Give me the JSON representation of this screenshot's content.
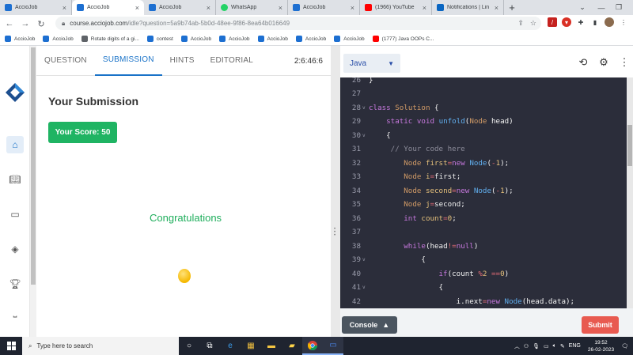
{
  "browser": {
    "tabs": [
      {
        "label": "AccioJob",
        "active": false,
        "icon": "acciojob-icon"
      },
      {
        "label": "AccioJob",
        "active": true,
        "icon": "acciojob-icon"
      },
      {
        "label": "AccioJob",
        "active": false,
        "icon": "acciojob-icon"
      },
      {
        "label": "WhatsApp",
        "active": false,
        "icon": "whatsapp-icon"
      },
      {
        "label": "AccioJob",
        "active": false,
        "icon": "acciojob-icon"
      },
      {
        "label": "(1966) YouTube",
        "active": false,
        "icon": "youtube-icon"
      },
      {
        "label": "Notifications | Lin",
        "active": false,
        "icon": "linkedin-icon"
      }
    ],
    "url_host": "course.acciojob.com",
    "url_path": "/idle?question=5a9b74ab-5b0d-48ee-9f86-8ea64b016649",
    "bookmarks": [
      {
        "label": "AccioJob",
        "icon": "acciojob-icon"
      },
      {
        "label": "AccioJob",
        "icon": "acciojob-icon"
      },
      {
        "label": "Rotate digits of a gi...",
        "icon": "link-icon"
      },
      {
        "label": "contest",
        "icon": "acciojob-icon"
      },
      {
        "label": "AccioJob",
        "icon": "acciojob-icon"
      },
      {
        "label": "AccioJob",
        "icon": "acciojob-icon"
      },
      {
        "label": "AccioJob",
        "icon": "acciojob-icon"
      },
      {
        "label": "AccioJob",
        "icon": "acciojob-icon"
      },
      {
        "label": "AccioJob",
        "icon": "acciojob-icon"
      },
      {
        "label": "(1777) Java OOPs C...",
        "icon": "youtube-icon"
      }
    ]
  },
  "panel": {
    "tabs": [
      "QUESTION",
      "SUBMISSION",
      "HINTS",
      "EDITORIAL"
    ],
    "active_tab": "SUBMISSION",
    "timer": "2:6:46:6",
    "title": "Your Submission",
    "score": "Your Score: 50",
    "congrats": "Congratulations"
  },
  "editor": {
    "language": "Java",
    "console_label": "Console",
    "submit_label": "Submit",
    "lines": [
      {
        "n": "26",
        "fold": false,
        "html": "<span class='vr'>}</span>"
      },
      {
        "n": "27",
        "fold": false,
        "html": ""
      },
      {
        "n": "28",
        "fold": true,
        "html": "<span class='kw'>class</span> <span class='ty'>Solution</span> <span class='vr'>{</span>"
      },
      {
        "n": "29",
        "fold": false,
        "html": "    <span class='kw'>static</span> <span class='kw'>void</span> <span class='fn'>unfold</span><span class='vr'>(</span><span class='ty'>Node</span> <span class='vr'>head)</span>"
      },
      {
        "n": "30",
        "fold": true,
        "html": "    <span class='vr'>{</span>"
      },
      {
        "n": "31",
        "fold": false,
        "html": "     <span class='cm'>// Your code here</span>"
      },
      {
        "n": "32",
        "fold": false,
        "html": "        <span class='ty'>Node</span> <span class='nm'>first</span><span class='op'>=</span><span class='kw'>new</span> <span class='fn'>Node</span><span class='vr'>(</span><span class='op'>-</span><span class='nm'>1</span><span class='vr'>);</span>"
      },
      {
        "n": "33",
        "fold": false,
        "html": "        <span class='ty'>Node</span> <span class='nm'>i</span><span class='op'>=</span><span class='vr'>first;</span>"
      },
      {
        "n": "34",
        "fold": false,
        "html": "        <span class='ty'>Node</span> <span class='nm'>second</span><span class='op'>=</span><span class='kw'>new</span> <span class='fn'>Node</span><span class='vr'>(</span><span class='op'>-</span><span class='nm'>1</span><span class='vr'>);</span>"
      },
      {
        "n": "35",
        "fold": false,
        "html": "        <span class='ty'>Node</span> <span class='nm'>j</span><span class='op'>=</span><span class='vr'>second;</span>"
      },
      {
        "n": "36",
        "fold": false,
        "html": "        <span class='kw'>int</span> <span class='nm'>count</span><span class='op'>=</span><span class='nm'>0</span><span class='vr'>;</span>"
      },
      {
        "n": "37",
        "fold": false,
        "html": ""
      },
      {
        "n": "38",
        "fold": false,
        "html": "        <span class='kw'>while</span><span class='vr'>(head</span><span class='op'>!=</span><span class='kw'>null</span><span class='vr'>)</span>"
      },
      {
        "n": "39",
        "fold": true,
        "html": "            <span class='vr'>{</span>"
      },
      {
        "n": "40",
        "fold": false,
        "html": "                <span class='kw'>if</span><span class='vr'>(count</span> <span class='op'>%</span><span class='nm'>2</span> <span class='op'>==</span><span class='nm'>0</span><span class='vr'>)</span>"
      },
      {
        "n": "41",
        "fold": true,
        "html": "                <span class='vr'>{</span>"
      },
      {
        "n": "42",
        "fold": false,
        "html": "                    <span class='vr'>i.next</span><span class='op'>=</span><span class='kw'>new</span> <span class='fn'>Node</span><span class='vr'>(head.data);</span>"
      }
    ]
  },
  "taskbar": {
    "search_placeholder": "Type here to search",
    "lang": "ENG",
    "time": "19:52",
    "date": "26-02-2023"
  }
}
